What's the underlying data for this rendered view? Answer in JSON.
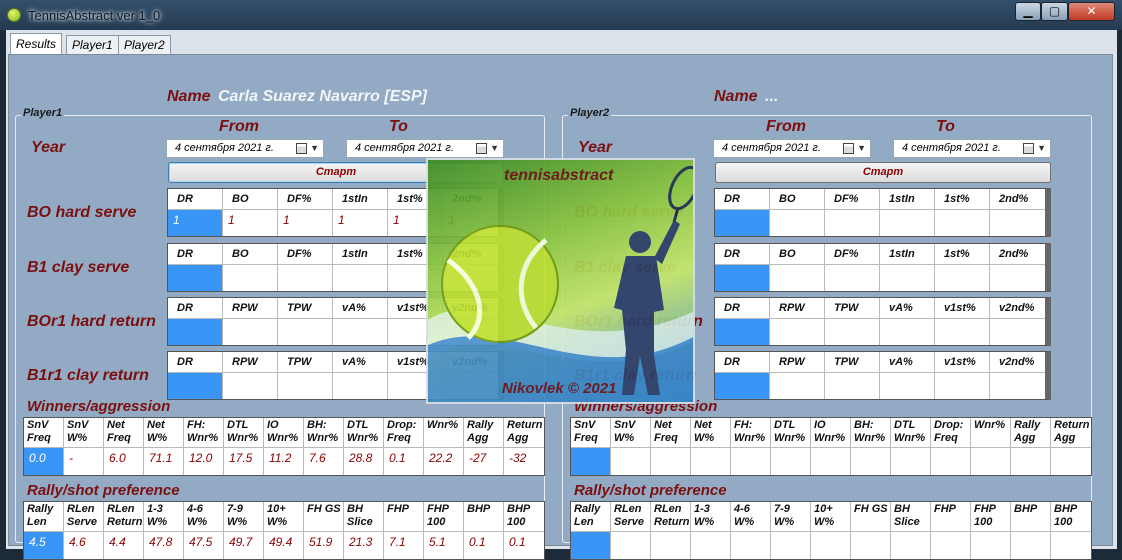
{
  "window": {
    "title": "TennisAbstract ver 1_0",
    "min": "▁",
    "max": "▢",
    "close": "✕"
  },
  "tabs": [
    {
      "label": "Results"
    },
    {
      "label": "Player1"
    },
    {
      "label": "Player2"
    }
  ],
  "splash": {
    "brand": "tennisabstract",
    "credit": "Nikovlek © 2021"
  },
  "player1": {
    "group_label": "Player1",
    "name_label": "Name",
    "name_value": "Carla Suarez Navarro [ESP]",
    "from_label": "From",
    "to_label": "To",
    "year_label": "Year",
    "from_date": "4 сентября 2021 г.",
    "to_date": "4 сентября 2021 г.",
    "start_label": "Старт",
    "sections": {
      "bo_hard_serve": {
        "label": "BO hard serve",
        "headers": [
          "DR",
          "BO",
          "DF%",
          "1stIn",
          "1st%",
          "2nd%"
        ],
        "values": [
          "1",
          "1",
          "1",
          "1",
          "1",
          "1"
        ]
      },
      "b1_clay_serve": {
        "label": "B1 clay serve",
        "headers": [
          "DR",
          "BO",
          "DF%",
          "1stIn",
          "1st%",
          "2nd%"
        ],
        "values": [
          "",
          "",
          "",
          "",
          "",
          ""
        ]
      },
      "bor1_hard_return": {
        "label": "BOr1 hard return",
        "headers": [
          "DR",
          "RPW",
          "TPW",
          "vA%",
          "v1st%",
          "v2nd%"
        ],
        "values": [
          "",
          "",
          "",
          "",
          "",
          ""
        ]
      },
      "b1r1_clay_return": {
        "label": "B1r1 clay return",
        "headers": [
          "DR",
          "RPW",
          "TPW",
          "vA%",
          "v1st%",
          "v2nd%"
        ],
        "values": [
          "",
          "",
          "",
          "",
          "",
          ""
        ]
      }
    },
    "winners": {
      "label": "Winners/aggression",
      "headers": [
        "SnV Freq",
        "SnV W%",
        "Net Freq",
        "Net W%",
        "FH: Wnr%",
        "DTL Wnr%",
        "IO Wnr%",
        "BH: Wnr%",
        "DTL Wnr%",
        "Drop: Freq",
        "Wnr%",
        "Rally Agg",
        "Return Agg"
      ],
      "values": [
        "0.0",
        "-",
        "6.0",
        "71.1",
        "12.0",
        "17.5",
        "11.2",
        "7.6",
        "28.8",
        "0.1",
        "22.2",
        "-27",
        "-32"
      ]
    },
    "rally": {
      "label": "Rally/shot preference",
      "headers": [
        "Rally Len",
        "RLen Serve",
        "RLen Return",
        "1-3 W%",
        "4-6 W%",
        "7-9 W%",
        "10+ W%",
        "FH GS",
        "BH Slice",
        "FHP",
        "FHP 100",
        "BHP",
        "BHP 100"
      ],
      "values": [
        "4.5",
        "4.6",
        "4.4",
        "47.8",
        "47.5",
        "49.7",
        "49.4",
        "51.9",
        "21.3",
        "7.1",
        "5.1",
        "0.1",
        "0.1"
      ]
    }
  },
  "player2": {
    "group_label": "Player2",
    "name_label": "Name",
    "name_value": "...",
    "from_label": "From",
    "to_label": "To",
    "year_label": "Year",
    "from_date": "4 сентября 2021 г.",
    "to_date": "4 сентября 2021 г.",
    "start_label": "Старт",
    "sections": {
      "bo_hard_serve": {
        "label": "BO hard serve",
        "headers": [
          "DR",
          "BO",
          "DF%",
          "1stIn",
          "1st%",
          "2nd%"
        ],
        "values": [
          "",
          "",
          "",
          "",
          "",
          ""
        ]
      },
      "b1_clay_serve": {
        "label": "B1 clay serve",
        "headers": [
          "DR",
          "BO",
          "DF%",
          "1stIn",
          "1st%",
          "2nd%"
        ],
        "values": [
          "",
          "",
          "",
          "",
          "",
          ""
        ]
      },
      "bor1_hard_return": {
        "label": "BOr1 hard return",
        "headers": [
          "DR",
          "RPW",
          "TPW",
          "vA%",
          "v1st%",
          "v2nd%"
        ],
        "values": [
          "",
          "",
          "",
          "",
          "",
          ""
        ]
      },
      "b1r1_clay_return": {
        "label": "B1r1 clay return",
        "headers": [
          "DR",
          "RPW",
          "TPW",
          "vA%",
          "v1st%",
          "v2nd%"
        ],
        "values": [
          "",
          "",
          "",
          "",
          "",
          ""
        ]
      }
    },
    "winners": {
      "label": "Winners/aggression",
      "headers": [
        "SnV Freq",
        "SnV W%",
        "Net Freq",
        "Net W%",
        "FH: Wnr%",
        "DTL Wnr%",
        "IO Wnr%",
        "BH: Wnr%",
        "DTL Wnr%",
        "Drop: Freq",
        "Wnr%",
        "Rally Agg",
        "Return Agg"
      ],
      "values": [
        "",
        "",
        "",
        "",
        "",
        "",
        "",
        "",
        "",
        "",
        "",
        "",
        ""
      ]
    },
    "rally": {
      "label": "Rally/shot preference",
      "headers": [
        "Rally Len",
        "RLen Serve",
        "RLen Return",
        "1-3 W%",
        "4-6 W%",
        "7-9 W%",
        "10+ W%",
        "FH GS",
        "BH Slice",
        "FHP",
        "FHP 100",
        "BHP",
        "BHP 100"
      ],
      "values": [
        "",
        "",
        "",
        "",
        "",
        "",
        "",
        "",
        "",
        "",
        "",
        "",
        ""
      ]
    }
  }
}
